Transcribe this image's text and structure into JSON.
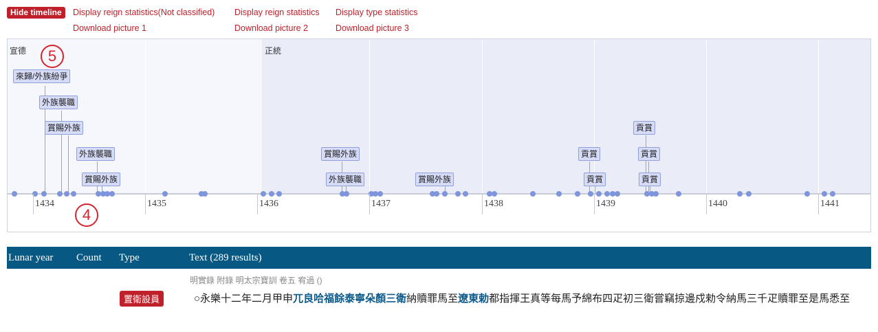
{
  "toolbar": {
    "hide_timeline": "Hide timeline",
    "links": [
      "Display reign statistics(Not classified)",
      "Display reign statistics",
      "Display type statistics",
      "Download picture 1",
      "Download picture 2",
      "Download picture 3"
    ]
  },
  "timeline": {
    "reigns": [
      "宣德",
      "正統"
    ],
    "years": [
      "1434",
      "1435",
      "1436",
      "1437",
      "1438",
      "1439",
      "1440",
      "1441"
    ],
    "events": [
      "來歸/外族紛爭",
      "外族襲職",
      "賞賜外族",
      "外族襲職",
      "賞賜外族",
      "賞賜外族",
      "外族襲職",
      "賞賜外族",
      "貢賞",
      "貢賞",
      "貢賞",
      "貢賞",
      "貢賞"
    ],
    "annotations": [
      "5",
      "4"
    ]
  },
  "table": {
    "columns": [
      "Lunar year",
      "Count",
      "Type",
      "Text (289 results)"
    ],
    "rows": [
      {
        "source": "明實錄 附錄 明太宗寶訓 卷五 宥過 ()",
        "type": "置衛設員",
        "text_parts": [
          "○永樂十二年二月甲申",
          "兀良哈福餘泰寧朵顏三衛",
          "納贖罪馬至",
          "遼東",
          "勅",
          "都指揮王真等每馬予綿布四疋初三衛嘗竊掠邊戍勑令納馬三千疋贖罪至是馬悉至"
        ]
      }
    ]
  }
}
